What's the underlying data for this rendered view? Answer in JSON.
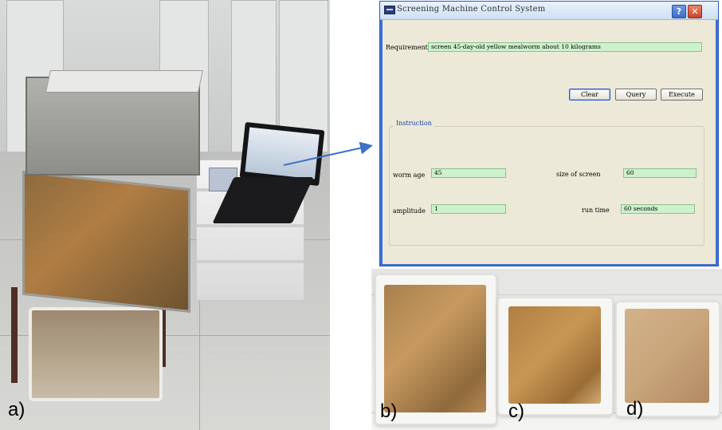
{
  "dialog": {
    "title": "Screening Machine Control System",
    "help_glyph": "?",
    "close_glyph": "✕",
    "requirement_label": "Requirement",
    "requirement_value": "screen 45-day-old yellow mealworm about 10 kilograms",
    "buttons": {
      "clear": "Clear",
      "query": "Query",
      "execute": "Execute"
    },
    "instruction": {
      "title": "Instruction",
      "worm_age_label": "worm age",
      "worm_age_value": "45",
      "size_of_screen_label": "size of screen",
      "size_of_screen_value": "60",
      "amplitude_label": "amplitude",
      "amplitude_value": "1",
      "run_time_label": "run time",
      "run_time_value": "60 seconds"
    }
  },
  "panel_labels": {
    "a": "a)",
    "b": "b)",
    "c": "c)",
    "d": "d)"
  },
  "colors": {
    "field_bg": "#cdf1cd",
    "dialog_frame": "#3d6fd6",
    "arrow": "#3d72c4"
  }
}
